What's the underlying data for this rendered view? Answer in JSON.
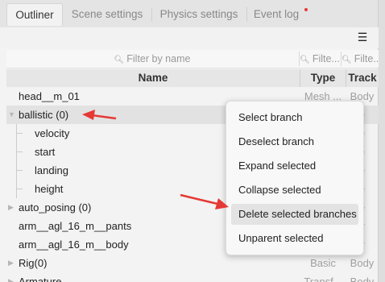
{
  "tabs": [
    {
      "label": "Outliner",
      "active": true
    },
    {
      "label": "Scene settings",
      "active": false
    },
    {
      "label": "Physics settings",
      "active": false
    },
    {
      "label": "Event log",
      "active": false,
      "notification": true
    }
  ],
  "toolbar": {
    "menu_icon": "hamburger-icon"
  },
  "filters": {
    "name_placeholder": "Filter by name",
    "type_placeholder": "Filte...",
    "track_placeholder": "Filte..."
  },
  "columns": {
    "name": "Name",
    "type": "Type",
    "track": "Track"
  },
  "rows": [
    {
      "name": "head__m_01",
      "type": "Mesh ...",
      "track": "Body"
    },
    {
      "name": "ballistic (0)",
      "type": "",
      "track": "e"
    },
    {
      "name": "velocity",
      "type": "",
      "track": "e"
    },
    {
      "name": "start",
      "type": "",
      "track": "e"
    },
    {
      "name": "landing",
      "type": "",
      "track": "e"
    },
    {
      "name": "height",
      "type": "",
      "track": "e"
    },
    {
      "name": "auto_posing (0)",
      "type": "",
      "track": "e"
    },
    {
      "name": "arm__agl_16_m__pants",
      "type": "",
      "track": "y"
    },
    {
      "name": "arm__agl_16_m__body",
      "type": "",
      "track": "y"
    },
    {
      "name": "Rig(0)",
      "type": "Basic",
      "track": "Body"
    },
    {
      "name": "Armature",
      "type": "Transf...",
      "track": "Body"
    }
  ],
  "context_menu": {
    "items": [
      "Select branch",
      "Deselect branch",
      "Expand selected",
      "Collapse selected",
      "Delete selected branches",
      "Unparent selected"
    ],
    "highlighted": "Delete selected branches"
  },
  "colors": {
    "annotation_arrow": "#e53935",
    "notification_dot": "#e53935"
  }
}
